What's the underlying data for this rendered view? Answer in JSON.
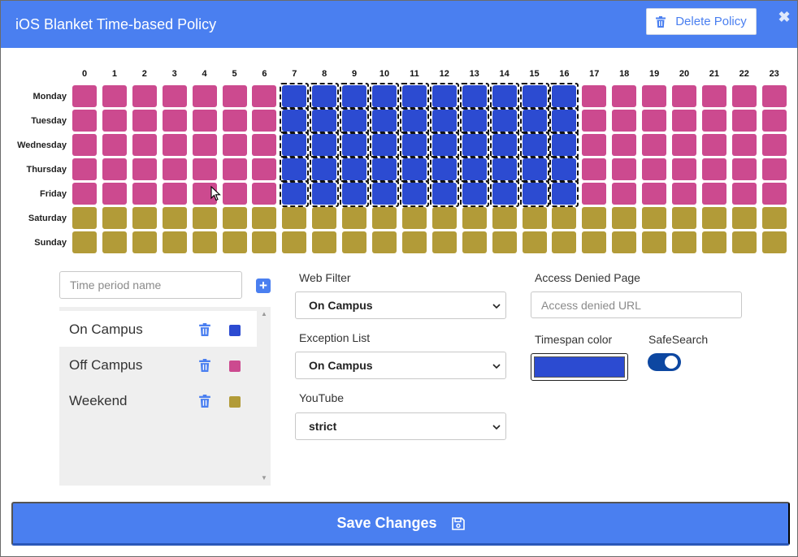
{
  "header": {
    "title": "iOS Blanket Time-based Policy",
    "delete_label": "Delete Policy",
    "close_glyph": "✖",
    "close_icon": "close-icon",
    "delete_icon": "trash-icon"
  },
  "schedule": {
    "hours": [
      "0",
      "1",
      "2",
      "3",
      "4",
      "5",
      "6",
      "7",
      "8",
      "9",
      "10",
      "11",
      "12",
      "13",
      "14",
      "15",
      "16",
      "17",
      "18",
      "19",
      "20",
      "21",
      "22",
      "23"
    ],
    "days": [
      "Monday",
      "Tuesday",
      "Wednesday",
      "Thursday",
      "Friday",
      "Saturday",
      "Sunday"
    ],
    "rows": [
      [
        "off",
        "off",
        "off",
        "off",
        "off",
        "off",
        "off",
        "on",
        "on",
        "on",
        "on",
        "on",
        "on",
        "on",
        "on",
        "on",
        "on",
        "off",
        "off",
        "off",
        "off",
        "off",
        "off",
        "off"
      ],
      [
        "off",
        "off",
        "off",
        "off",
        "off",
        "off",
        "off",
        "on",
        "on",
        "on",
        "on",
        "on",
        "on",
        "on",
        "on",
        "on",
        "on",
        "off",
        "off",
        "off",
        "off",
        "off",
        "off",
        "off"
      ],
      [
        "off",
        "off",
        "off",
        "off",
        "off",
        "off",
        "off",
        "on",
        "on",
        "on",
        "on",
        "on",
        "on",
        "on",
        "on",
        "on",
        "on",
        "off",
        "off",
        "off",
        "off",
        "off",
        "off",
        "off"
      ],
      [
        "off",
        "off",
        "off",
        "off",
        "off",
        "off",
        "off",
        "on",
        "on",
        "on",
        "on",
        "on",
        "on",
        "on",
        "on",
        "on",
        "on",
        "off",
        "off",
        "off",
        "off",
        "off",
        "off",
        "off"
      ],
      [
        "off",
        "off",
        "off",
        "off",
        "off",
        "off",
        "off",
        "on",
        "on",
        "on",
        "on",
        "on",
        "on",
        "on",
        "on",
        "on",
        "on",
        "off",
        "off",
        "off",
        "off",
        "off",
        "off",
        "off"
      ],
      [
        "wk",
        "wk",
        "wk",
        "wk",
        "wk",
        "wk",
        "wk",
        "wk",
        "wk",
        "wk",
        "wk",
        "wk",
        "wk",
        "wk",
        "wk",
        "wk",
        "wk",
        "wk",
        "wk",
        "wk",
        "wk",
        "wk",
        "wk",
        "wk"
      ],
      [
        "wk",
        "wk",
        "wk",
        "wk",
        "wk",
        "wk",
        "wk",
        "wk",
        "wk",
        "wk",
        "wk",
        "wk",
        "wk",
        "wk",
        "wk",
        "wk",
        "wk",
        "wk",
        "wk",
        "wk",
        "wk",
        "wk",
        "wk",
        "wk"
      ]
    ],
    "selected_period": "on"
  },
  "colors": {
    "on": "#2c4bd1",
    "off": "#cc4a8f",
    "wk": "#b29b38",
    "accent": "#4a7ff0"
  },
  "periods": {
    "input_placeholder": "Time period name",
    "add_glyph": "+",
    "items": [
      {
        "key": "on",
        "label": "On Campus"
      },
      {
        "key": "off",
        "label": "Off Campus"
      },
      {
        "key": "wk",
        "label": "Weekend"
      }
    ],
    "scroll_up_glyph": "▲",
    "scroll_down_glyph": "▼"
  },
  "settings": {
    "web_filter_label": "Web Filter",
    "web_filter_value": "On Campus",
    "exception_label": "Exception List",
    "exception_value": "On Campus",
    "youtube_label": "YouTube",
    "youtube_value": "strict",
    "access_denied_label": "Access Denied Page",
    "access_denied_placeholder": "Access denied URL",
    "timespan_color_label": "Timespan color",
    "timespan_color": "#2c4bd1",
    "safesearch_label": "SafeSearch",
    "safesearch_on": true
  },
  "footer": {
    "save_label": "Save Changes",
    "save_icon": "floppy-disk-icon"
  }
}
